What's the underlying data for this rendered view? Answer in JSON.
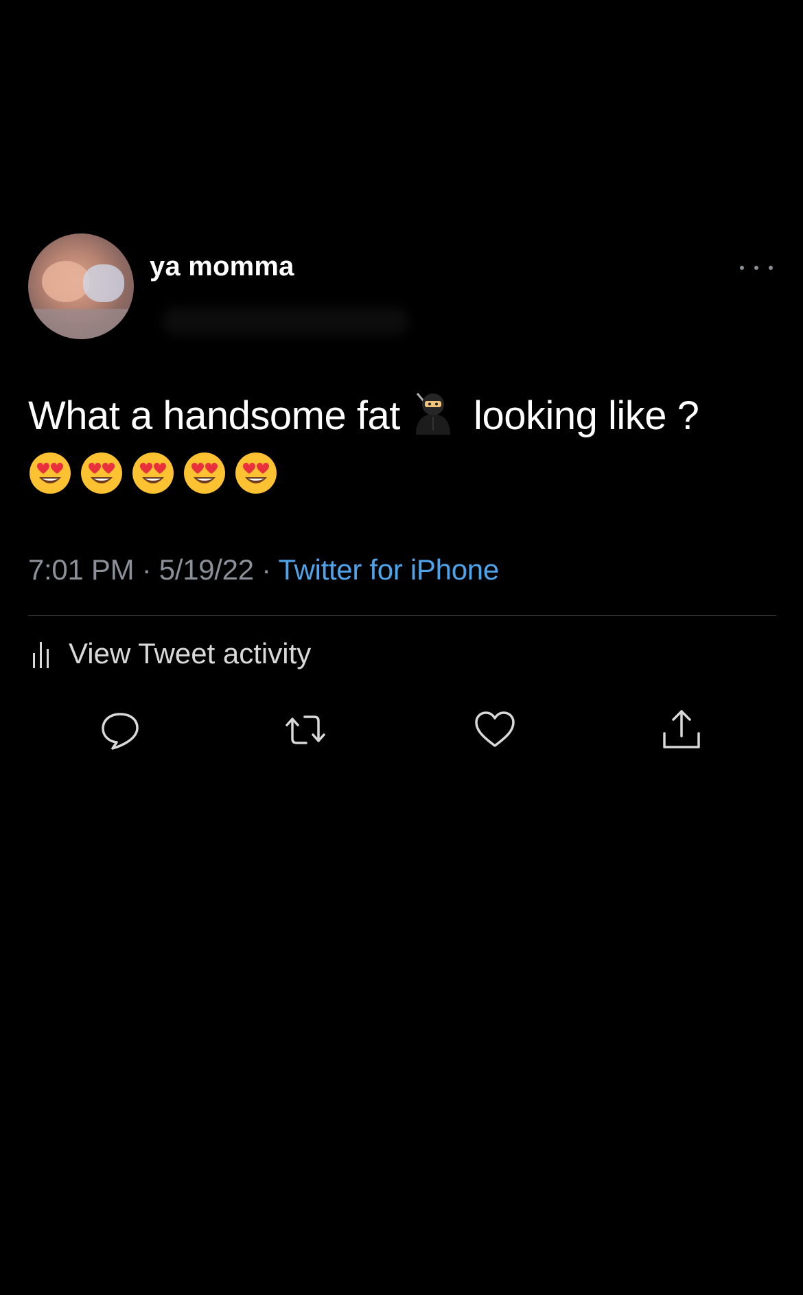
{
  "tweet": {
    "display_name": "ya momma",
    "text_before_emoji": "What a handsome fat",
    "text_after_emoji": " looking like ?",
    "inline_emoji_icon": "ninja-icon",
    "trailing_emojis": [
      "heart-eyes-icon",
      "heart-eyes-icon",
      "heart-eyes-icon",
      "heart-eyes-icon",
      "heart-eyes-icon"
    ],
    "time": "7:01 PM",
    "separator": " · ",
    "date": "5/19/22",
    "source": "Twitter for iPhone"
  },
  "activity": {
    "label": "View Tweet activity",
    "icon": "bar-chart-icon"
  },
  "actions": [
    {
      "name": "reply",
      "icon": "speech-bubble-icon"
    },
    {
      "name": "retweet",
      "icon": "retweet-icon"
    },
    {
      "name": "like",
      "icon": "heart-icon"
    },
    {
      "name": "share",
      "icon": "share-icon"
    }
  ],
  "colors": {
    "background": "#000000",
    "text": "#ffffff",
    "meta": "#8b9199",
    "link": "#4fa3e8",
    "icon": "#d9d9d9"
  }
}
